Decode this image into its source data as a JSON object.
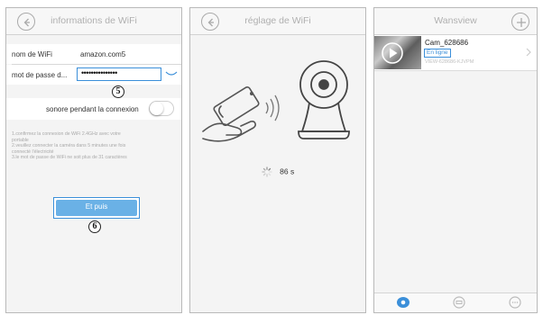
{
  "screen1": {
    "title": "informations de WiFi",
    "wifi_name_label": "nom de WiFi",
    "wifi_name_value": "amazon.com5",
    "password_label": "mot de passe d...",
    "password_value": "•••••••••••••••",
    "step5": "5",
    "sound_label": "sonore pendant la connexion",
    "sound_on": false,
    "notes": [
      "1.confirmez la connexion de WiFi 2.4GHz avec votre",
      "portable",
      "2.veuillez connecter la caméra dans 5 minutes une fois",
      "connecté l'électricité",
      "3.le mot de passe de WiFi ne soit plus de 31 caractères"
    ],
    "next_button": "Et puis",
    "step6": "6"
  },
  "screen2": {
    "title": "réglage de WiFi",
    "countdown": "86 s"
  },
  "screen3": {
    "title": "Wansview",
    "camera": {
      "name": "Cam_628686",
      "status": "En ligne",
      "id": "VIEW-628686-KJVPM"
    }
  },
  "icons": {
    "back": "back-arrow-icon",
    "add": "plus-icon",
    "eye": "eye-icon",
    "spinner": "loading-spinner-icon",
    "play": "play-icon",
    "chevron": "chevron-right-icon",
    "tab1": "camera-tab-icon",
    "tab2": "cloud-tab-icon",
    "tab3": "more-tab-icon"
  },
  "colors": {
    "accent": "#3b8fd9",
    "button": "#6ab1e6",
    "muted": "#a9a9a9"
  }
}
